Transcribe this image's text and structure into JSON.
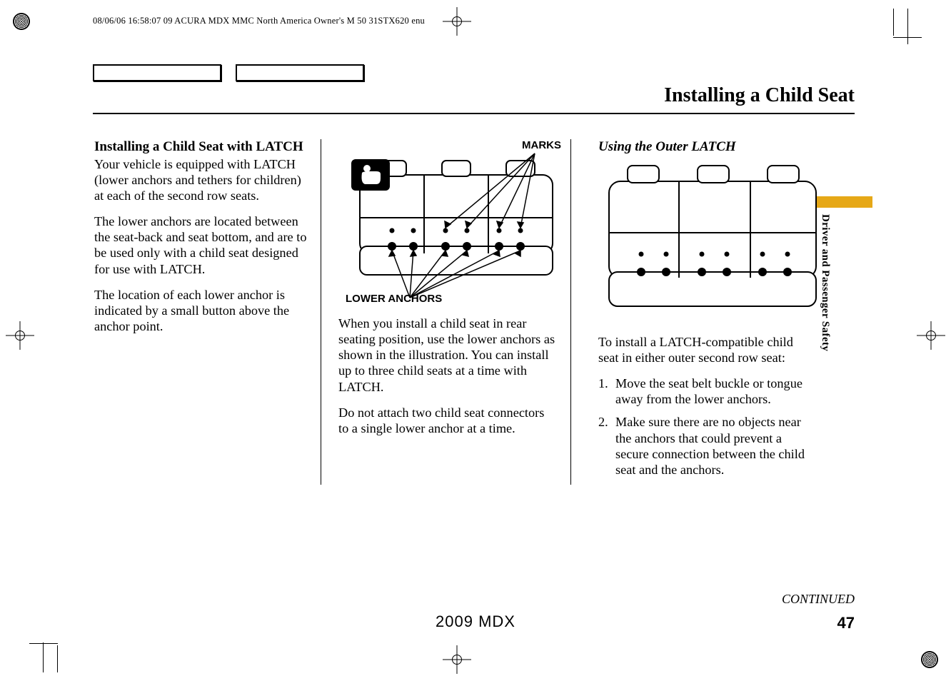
{
  "header_meta": "08/06/06 16:58:07   09 ACURA MDX MMC North America Owner's M 50 31STX620 enu",
  "page_heading": "Installing a Child Seat",
  "tab_label": "Driver and Passenger Safety",
  "col1": {
    "heading": "Installing a Child Seat with LATCH",
    "p1": "Your vehicle is equipped with LATCH (lower anchors and tethers for children) at each of the second row seats.",
    "p2": "The lower anchors are located between the seat-back and seat bottom, and are to be used only with a child seat designed for use with LATCH.",
    "p3": "The location of each lower anchor is indicated by a small button above the anchor point."
  },
  "col2": {
    "callout_marks": "MARKS",
    "callout_anchors": "LOWER ANCHORS",
    "p1": "When you install a child seat in rear seating position, use the lower anchors as shown in the illustration. You can install up to three child seats at a time with LATCH.",
    "p2": "Do not attach two child seat connectors to a single lower anchor at a time."
  },
  "col3": {
    "heading": "Using the Outer LATCH",
    "p1": "To install a LATCH-compatible child seat in either outer second row seat:",
    "steps": [
      {
        "num": "1.",
        "text": "Move the seat belt buckle or tongue away from the lower anchors."
      },
      {
        "num": "2.",
        "text": "Make sure there are no objects near the anchors that could prevent a secure connection between the child seat and the anchors."
      }
    ]
  },
  "continued": "CONTINUED",
  "footer_model": "2009  MDX",
  "page_num": "47"
}
